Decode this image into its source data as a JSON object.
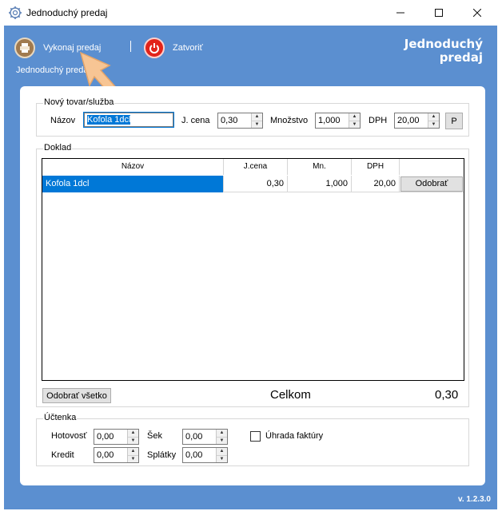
{
  "window": {
    "title": "Jednoduchý predaj",
    "min_icon": "minimize-icon",
    "max_icon": "maximize-icon",
    "close_icon": "close-icon"
  },
  "toolbar": {
    "sale_label": "Vykonaj predaj",
    "close_label": "Zatvoriť",
    "ribbon_tab": "Jednoduchý predaj",
    "header_title_line1": "Jednoduchý",
    "header_title_line2": "predaj"
  },
  "new_item": {
    "group_label": "Nový tovar/služba",
    "name_label": "Názov",
    "name_value": "Kofola 1dcl",
    "price_label": "J. cena",
    "price_value": "0,30",
    "qty_label": "Množstvo",
    "qty_value": "1,000",
    "vat_label": "DPH",
    "vat_value": "20,00",
    "add_button": "P"
  },
  "receipt": {
    "group_label": "Doklad",
    "columns": [
      "Názov",
      "J.cena",
      "Mn.",
      "DPH",
      ""
    ],
    "rows": [
      {
        "name": "Kofola 1dcl",
        "price": "0,30",
        "qty": "1,000",
        "vat": "20,00",
        "action": "Odobrať"
      }
    ],
    "remove_all_button": "Odobrať všetko",
    "total_label": "Celkom",
    "total_value": "0,30"
  },
  "payment": {
    "group_label": "Účtenka",
    "cash_label": "Hotovosť",
    "cash_value": "0,00",
    "check_label": "Šek",
    "check_value": "0,00",
    "credit_label": "Kredit",
    "credit_value": "0,00",
    "installments_label": "Splátky",
    "installments_value": "0,00",
    "invoice_label": "Úhrada faktúry"
  },
  "version": "v. 1.2.3.0",
  "colors": {
    "frame": "#5b8fd0",
    "selection": "#0078d7"
  }
}
